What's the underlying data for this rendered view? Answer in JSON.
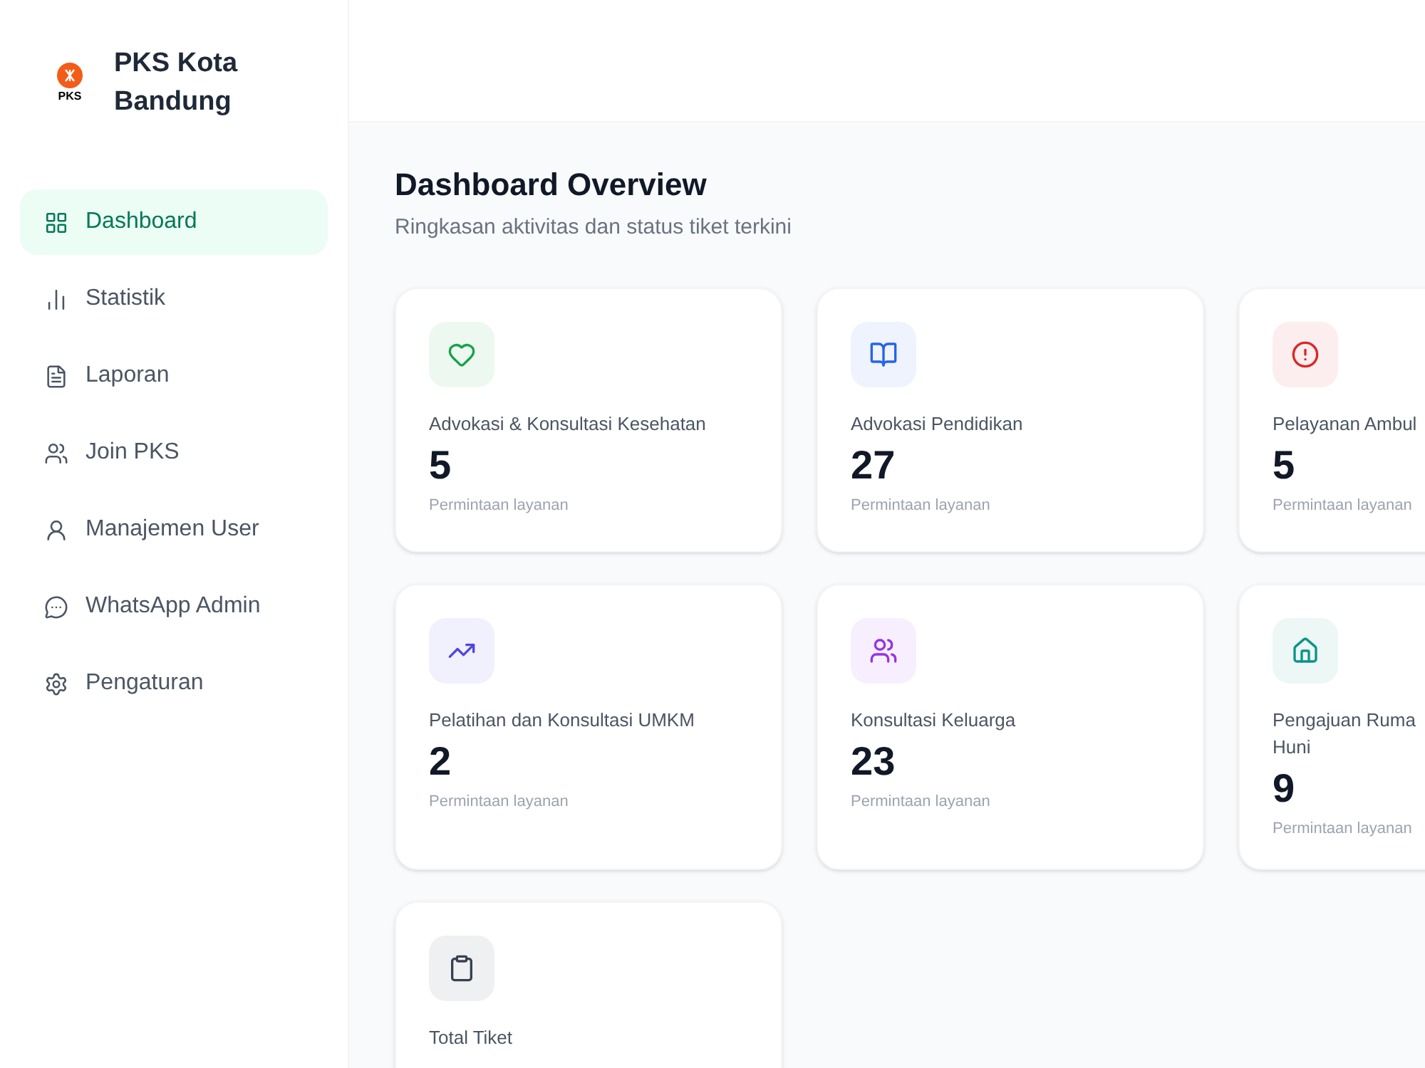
{
  "sidebar": {
    "brand": {
      "logo_text": "PKS",
      "title": "PKS Kota Bandung"
    },
    "items": [
      {
        "label": "Dashboard",
        "selected": true
      },
      {
        "label": "Statistik",
        "selected": false
      },
      {
        "label": "Laporan",
        "selected": false
      },
      {
        "label": "Join PKS",
        "selected": false
      },
      {
        "label": "Manajemen User",
        "selected": false
      },
      {
        "label": "WhatsApp Admin",
        "selected": false
      },
      {
        "label": "Pengaturan",
        "selected": false
      }
    ]
  },
  "page": {
    "title": "Dashboard Overview",
    "subtitle": "Ringkasan aktivitas dan status tiket terkini"
  },
  "cards": [
    {
      "title": "Advokasi & Konsultasi Kesehatan",
      "value": "5",
      "caption": "Permintaan layanan",
      "color": "#16a34a"
    },
    {
      "title": "Advokasi Pendidikan",
      "value": "27",
      "caption": "Permintaan layanan",
      "color": "#2563eb"
    },
    {
      "title": "Pelayanan Ambul",
      "value": "5",
      "caption": "Permintaan layanan",
      "color": "#dc2626"
    },
    {
      "title": "Pelatihan dan Konsultasi UMKM",
      "value": "2",
      "caption": "Permintaan layanan",
      "color": "#4f46e5"
    },
    {
      "title": "Konsultasi Keluarga",
      "value": "23",
      "caption": "Permintaan layanan",
      "color": "#9333ea"
    },
    {
      "title": "Pengajuan Ruma\nHuni",
      "value": "9",
      "caption": "Permintaan layanan",
      "color": "#0d9488"
    },
    {
      "title": "Total Tiket",
      "color": "#374151"
    }
  ]
}
